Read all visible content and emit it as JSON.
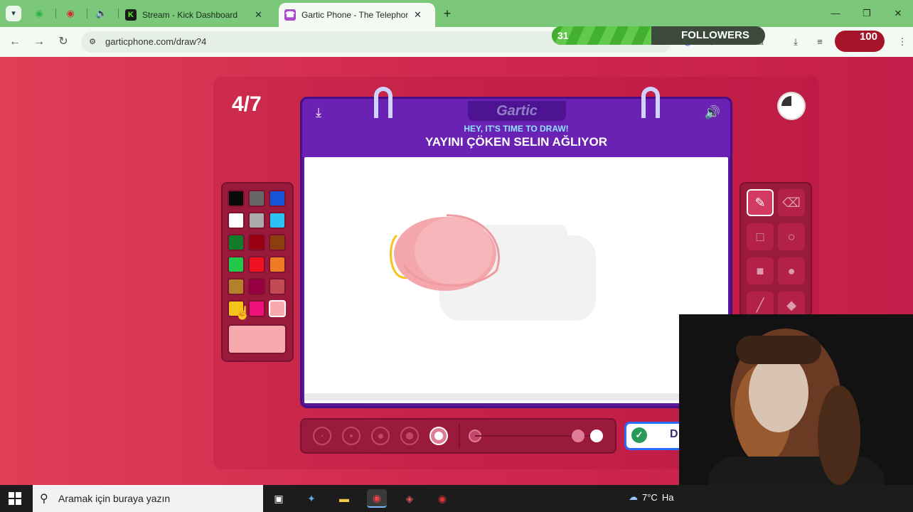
{
  "browser": {
    "tabs": [
      {
        "title": "Stream - Kick Dashboard",
        "icon": "kick-icon",
        "active": false
      },
      {
        "title": "Gartic Phone - The Telephone G",
        "icon": "gartic-icon",
        "active": true
      }
    ],
    "url": "garticphone.com/draw?4"
  },
  "stream_overlay": {
    "followers_count": "31",
    "followers_label": "FOLLOWERS",
    "followers_progress": 0.31,
    "badge_value": "100"
  },
  "game": {
    "round": "4/7",
    "logo": "Gartic",
    "subheading": "HEY, IT'S TIME TO DRAW!",
    "prompt": "YAYINI ÇÖKEN SELIN AĞLIYOR",
    "timer_remaining": 0.75,
    "palette": [
      "#0a0a0a",
      "#666666",
      "#1653d6",
      "#ffffff",
      "#aaaaaa",
      "#2bc3f2",
      "#127c2a",
      "#990011",
      "#8c3e10",
      "#22c84a",
      "#f01220",
      "#f07b25",
      "#b4802a",
      "#990044",
      "#c24a55",
      "#f6c21c",
      "#f0127c",
      "#f7a9ae"
    ],
    "selected_color": "#f7a9ae",
    "tools": [
      {
        "name": "pencil-tool",
        "icon": "✎",
        "active": true
      },
      {
        "name": "eraser-tool",
        "icon": "⌫",
        "active": false
      },
      {
        "name": "rectangle-tool",
        "icon": "□",
        "active": false
      },
      {
        "name": "ellipse-tool",
        "icon": "○",
        "active": false
      },
      {
        "name": "filled-rectangle-tool",
        "icon": "■",
        "active": false
      },
      {
        "name": "filled-ellipse-tool",
        "icon": "●",
        "active": false
      },
      {
        "name": "line-tool",
        "icon": "╱",
        "active": false
      },
      {
        "name": "fill-bucket-tool",
        "icon": "◆",
        "active": false
      }
    ],
    "brush_sizes": 5,
    "active_brush_size": 5,
    "opacity_level": 1.0,
    "done_label": "D"
  },
  "taskbar": {
    "search_placeholder": "Aramak için buraya yazın",
    "weather": "7°C",
    "weather_more": "Ha"
  }
}
